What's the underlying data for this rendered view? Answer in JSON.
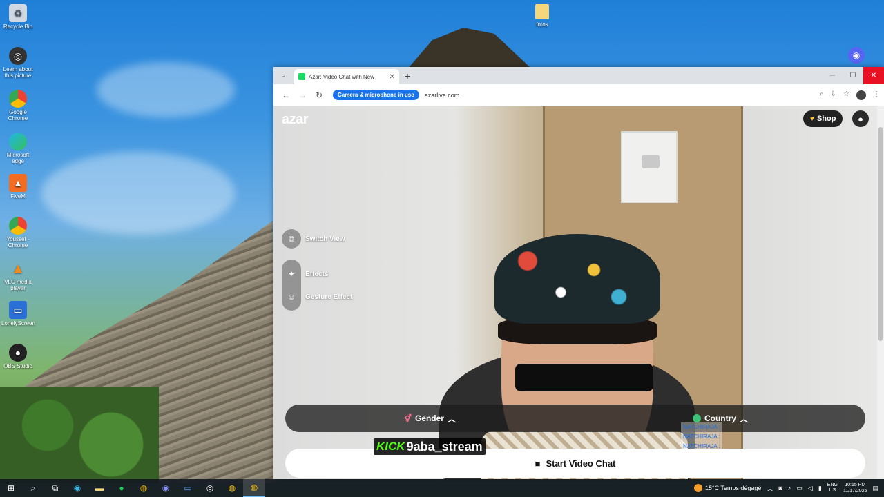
{
  "desktop": {
    "icons": [
      {
        "label": "Recycle Bin",
        "icon": "recycle-bin-icon"
      },
      {
        "label": "Learn about this picture",
        "icon": "camera-icon"
      },
      {
        "label": "Google Chrome",
        "icon": "chrome-icon"
      },
      {
        "label": "Microsoft edge",
        "icon": "edge-icon"
      },
      {
        "label": "FiveM",
        "icon": "fivem-icon"
      },
      {
        "label": "Youssef - Chrome",
        "icon": "chrome-icon"
      },
      {
        "label": "VLC media player",
        "icon": "vlc-icon"
      },
      {
        "label": "LonelyScreen",
        "icon": "monitor-icon"
      },
      {
        "label": "OBS Studio",
        "icon": "obs-icon"
      }
    ],
    "folder": {
      "label": "fotos",
      "icon": "folder-icon"
    }
  },
  "browser": {
    "tab_title": "Azar: Video Chat with New",
    "badge": "Camera & microphone in use",
    "url": "azarlive.com"
  },
  "page": {
    "brand": "azar",
    "shop_label": "Shop",
    "tools": {
      "switch_view": "Switch View",
      "effects": "Effects",
      "gesture_effect": "Gesture Effect"
    },
    "filters": {
      "gender": "Gender",
      "country": "Country"
    },
    "start_label": "Start Video Chat",
    "chat_lines": [
      "NATCHIRAJA :",
      "NATCHIRAJA :",
      "NATCHIRAJA :"
    ]
  },
  "overlay": {
    "kick": "KICK",
    "username": "9aba_stream"
  },
  "taskbar": {
    "weather": "15°C  Temps dégagé",
    "lang_top": "ENG",
    "lang_bottom": "US",
    "time": "10:15 PM",
    "date": "11/17/2025"
  },
  "colors": {
    "accent": "#1a73e8",
    "close_red": "#e81123",
    "kick_green": "#53fc18"
  }
}
